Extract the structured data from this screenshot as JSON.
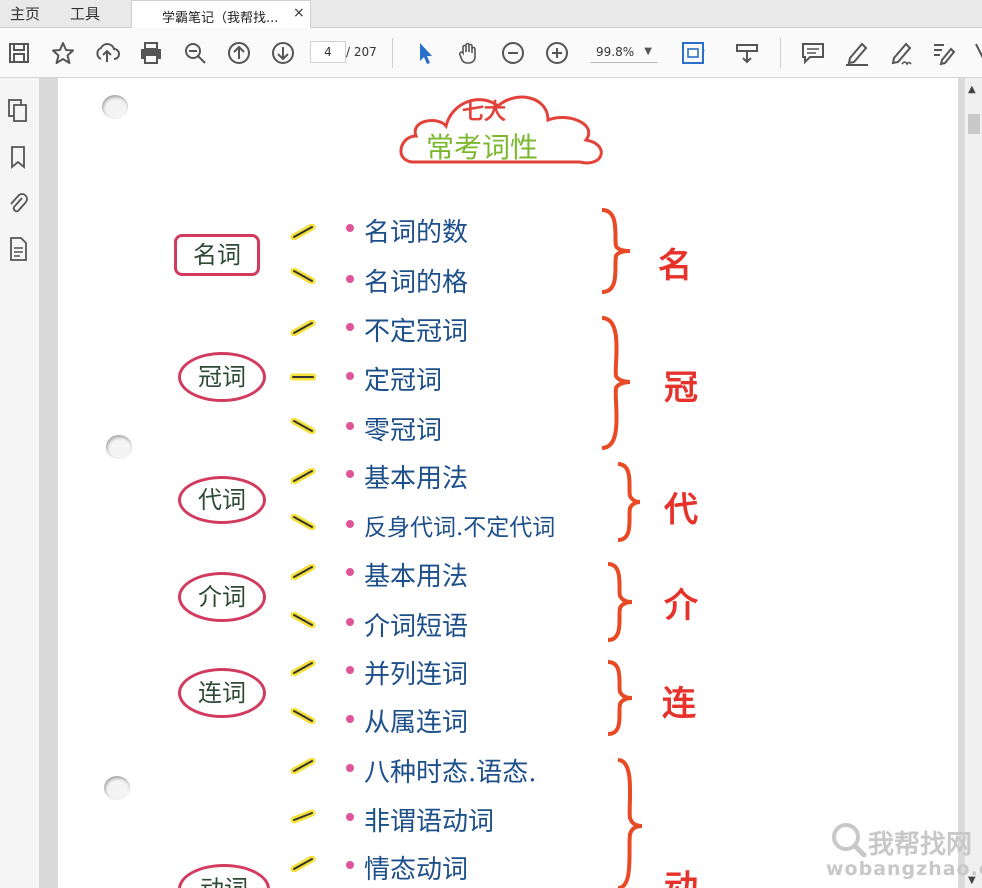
{
  "tabs": {
    "home": "主页",
    "tools": "工具",
    "document": "学霸笔记（我帮找...",
    "close": "×"
  },
  "toolbar": {
    "page_current": "4",
    "page_total": "/ 207",
    "zoom": "99.8%",
    "icons": [
      "save-icon",
      "star-icon",
      "upload-icon",
      "print-icon",
      "zoom-out-search-icon",
      "page-up-icon",
      "page-down-icon",
      "select-cursor-icon",
      "hand-icon",
      "minus-circle-icon",
      "plus-circle-icon",
      "fit-page-icon",
      "scroll-mode-icon",
      "comment-icon",
      "highlight-pen-icon",
      "sign-pen-icon",
      "edit-icon"
    ]
  },
  "left_panel": {
    "icons": [
      "pages-icon",
      "bookmark-icon",
      "attachment-icon",
      "document-properties-icon"
    ]
  },
  "note": {
    "cloud_top": "七大",
    "cloud_main": "常考词性",
    "groups": [
      {
        "label": "名词",
        "letter": "名",
        "items": [
          "名词的数",
          "名词的格"
        ]
      },
      {
        "label": "冠词",
        "letter": "冠",
        "items": [
          "不定冠词",
          "定冠词",
          "零冠词"
        ]
      },
      {
        "label": "代词",
        "letter": "代",
        "items": [
          "基本用法",
          "反身代词.不定代词"
        ]
      },
      {
        "label": "介词",
        "letter": "介",
        "items": [
          "基本用法",
          "介词短语"
        ]
      },
      {
        "label": "连词",
        "letter": "连",
        "items": [
          "并列连词",
          "从属连词"
        ]
      },
      {
        "label": "动词",
        "letter": "动",
        "items": [
          "八种时态.语态.",
          "非谓语动词",
          "情态动词"
        ]
      }
    ],
    "colors": {
      "oval": "#d23b5e",
      "item": "#1d4f8a",
      "letter": "#e6322a",
      "highlight": "#f5e13a",
      "dot": "#e0559a",
      "cloud_text": "#7cb82f"
    }
  },
  "watermark": {
    "cn": "我帮找网",
    "en": "wobangzhao.com"
  }
}
